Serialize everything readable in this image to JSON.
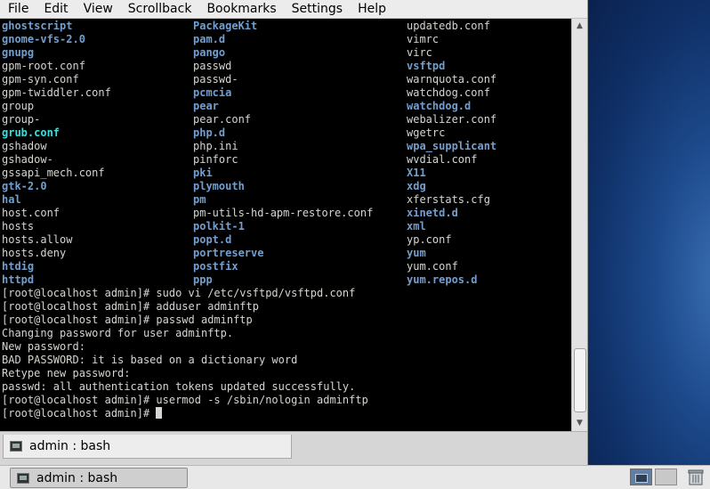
{
  "menubar": [
    "File",
    "Edit",
    "View",
    "Scrollback",
    "Bookmarks",
    "Settings",
    "Help"
  ],
  "listing": [
    [
      {
        "t": "ghostscript",
        "k": "dir"
      },
      {
        "t": "PackageKit",
        "k": "dir"
      },
      {
        "t": "updatedb.conf",
        "k": "file"
      }
    ],
    [
      {
        "t": "gnome-vfs-2.0",
        "k": "dir"
      },
      {
        "t": "pam.d",
        "k": "dir"
      },
      {
        "t": "vimrc",
        "k": "file"
      }
    ],
    [
      {
        "t": "gnupg",
        "k": "dir"
      },
      {
        "t": "pango",
        "k": "dir"
      },
      {
        "t": "virc",
        "k": "file"
      }
    ],
    [
      {
        "t": "gpm-root.conf",
        "k": "file"
      },
      {
        "t": "passwd",
        "k": "file"
      },
      {
        "t": "vsftpd",
        "k": "dir"
      }
    ],
    [
      {
        "t": "gpm-syn.conf",
        "k": "file"
      },
      {
        "t": "passwd-",
        "k": "file"
      },
      {
        "t": "warnquota.conf",
        "k": "file"
      }
    ],
    [
      {
        "t": "gpm-twiddler.conf",
        "k": "file"
      },
      {
        "t": "pcmcia",
        "k": "dir"
      },
      {
        "t": "watchdog.conf",
        "k": "file"
      }
    ],
    [
      {
        "t": "group",
        "k": "file"
      },
      {
        "t": "pear",
        "k": "dir"
      },
      {
        "t": "watchdog.d",
        "k": "dir"
      }
    ],
    [
      {
        "t": "group-",
        "k": "file"
      },
      {
        "t": "pear.conf",
        "k": "file"
      },
      {
        "t": "webalizer.conf",
        "k": "file"
      }
    ],
    [
      {
        "t": "grub.conf",
        "k": "link"
      },
      {
        "t": "php.d",
        "k": "dir"
      },
      {
        "t": "wgetrc",
        "k": "file"
      }
    ],
    [
      {
        "t": "gshadow",
        "k": "file"
      },
      {
        "t": "php.ini",
        "k": "file"
      },
      {
        "t": "wpa_supplicant",
        "k": "dir"
      }
    ],
    [
      {
        "t": "gshadow-",
        "k": "file"
      },
      {
        "t": "pinforc",
        "k": "file"
      },
      {
        "t": "wvdial.conf",
        "k": "file"
      }
    ],
    [
      {
        "t": "gssapi_mech.conf",
        "k": "file"
      },
      {
        "t": "pki",
        "k": "dir"
      },
      {
        "t": "X11",
        "k": "dir"
      }
    ],
    [
      {
        "t": "gtk-2.0",
        "k": "dir"
      },
      {
        "t": "plymouth",
        "k": "dir"
      },
      {
        "t": "xdg",
        "k": "dir"
      }
    ],
    [
      {
        "t": "hal",
        "k": "dir"
      },
      {
        "t": "pm",
        "k": "dir"
      },
      {
        "t": "xferstats.cfg",
        "k": "file"
      }
    ],
    [
      {
        "t": "host.conf",
        "k": "file"
      },
      {
        "t": "pm-utils-hd-apm-restore.conf",
        "k": "file"
      },
      {
        "t": "xinetd.d",
        "k": "dir"
      }
    ],
    [
      {
        "t": "hosts",
        "k": "file"
      },
      {
        "t": "polkit-1",
        "k": "dir"
      },
      {
        "t": "xml",
        "k": "dir"
      }
    ],
    [
      {
        "t": "hosts.allow",
        "k": "file"
      },
      {
        "t": "popt.d",
        "k": "dir"
      },
      {
        "t": "yp.conf",
        "k": "file"
      }
    ],
    [
      {
        "t": "hosts.deny",
        "k": "file"
      },
      {
        "t": "portreserve",
        "k": "dir"
      },
      {
        "t": "yum",
        "k": "dir"
      }
    ],
    [
      {
        "t": "htdig",
        "k": "dir"
      },
      {
        "t": "postfix",
        "k": "dir"
      },
      {
        "t": "yum.conf",
        "k": "file"
      }
    ],
    [
      {
        "t": "httpd",
        "k": "dir"
      },
      {
        "t": "ppp",
        "k": "dir"
      },
      {
        "t": "yum.repos.d",
        "k": "dir"
      }
    ]
  ],
  "output": [
    "[root@localhost admin]# sudo vi /etc/vsftpd/vsftpd.conf",
    "[root@localhost admin]# adduser adminftp",
    "[root@localhost admin]# passwd adminftp",
    "Changing password for user adminftp.",
    "New password:",
    "BAD PASSWORD: it is based on a dictionary word",
    "Retype new password:",
    "passwd: all authentication tokens updated successfully.",
    "[root@localhost admin]# usermod -s /sbin/nologin adminftp"
  ],
  "prompt": "[root@localhost admin]# ",
  "tab": {
    "label": "admin : bash",
    "icon": "terminal-icon"
  },
  "taskbar": {
    "label": "admin : bash",
    "icon": "terminal-icon"
  },
  "colors": {
    "directory": "#729fcf",
    "symlink": "#34e2e2",
    "text": "#d3d7cf",
    "background": "#000000"
  }
}
